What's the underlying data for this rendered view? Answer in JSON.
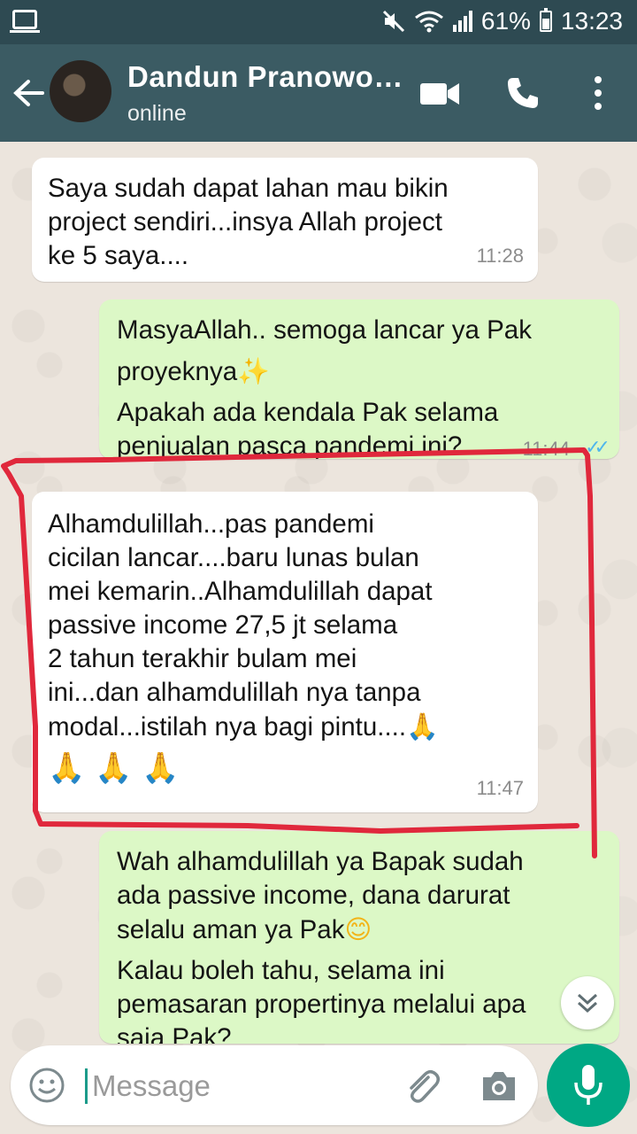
{
  "status_bar": {
    "battery": "61%",
    "time": "13:23"
  },
  "header": {
    "contact_name": "Dandun Pranowo…",
    "contact_status": "online"
  },
  "messages": [
    {
      "direction": "incoming",
      "text": "Saya sudah dapat lahan mau bikin\nproject  sendiri...insya Allah project\nke 5 saya....",
      "time": "11:28"
    },
    {
      "direction": "outgoing",
      "text_line1": "MasyaAllah.. semoga lancar ya Pak",
      "text_line2": "proyeknya",
      "text_line2_emoji": "✨",
      "text_line3": "Apakah ada kendala Pak selama\npenjualan pasca pandemi ini?",
      "time": "11:44",
      "status": "read"
    },
    {
      "direction": "incoming",
      "text": "Alhamdulillah...pas pandemi\ncicilan lancar....baru lunas bulan\nmei kemarin..Alhamdulillah dapat\npassive income 27,5 jt selama\n2 tahun terakhir bulam mei\nini...dan alhamdulillah nya tanpa\nmodal...istilah nya bagi pintu....",
      "emoji_inline": "🙏",
      "emoji_line": "🙏 🙏 🙏",
      "time": "11:47"
    },
    {
      "direction": "outgoing",
      "text_line1": "Wah alhamdulillah ya Bapak sudah\nada passive income, dana darurat\nselalu aman ya Pak",
      "text_line1_emoji": "😊",
      "text_line2": "Kalau boleh tahu, selama ini\npemasaran propertinya melalui apa\nsaja Pak?"
    }
  ],
  "input": {
    "placeholder": "Message"
  },
  "colors": {
    "header": "#3b5b63",
    "status_bar": "#2e4a52",
    "outgoing_bubble": "#dcf8c6",
    "incoming_bubble": "#ffffff",
    "mic_button": "#00a884",
    "annotation": "#e0283c",
    "read_ticks": "#4fb6ec"
  },
  "icons": {
    "status_left": "screenshot-icon",
    "mute": "mute-icon",
    "wifi": "wifi-icon",
    "signal": "signal-icon",
    "battery": "battery-icon",
    "back": "back-arrow-icon",
    "video": "video-call-icon",
    "phone": "phone-call-icon",
    "menu": "more-vert-icon",
    "scroll": "chevron-double-down-icon",
    "emoji": "emoji-icon",
    "attach": "paperclip-icon",
    "camera": "camera-icon",
    "mic": "microphone-icon"
  }
}
